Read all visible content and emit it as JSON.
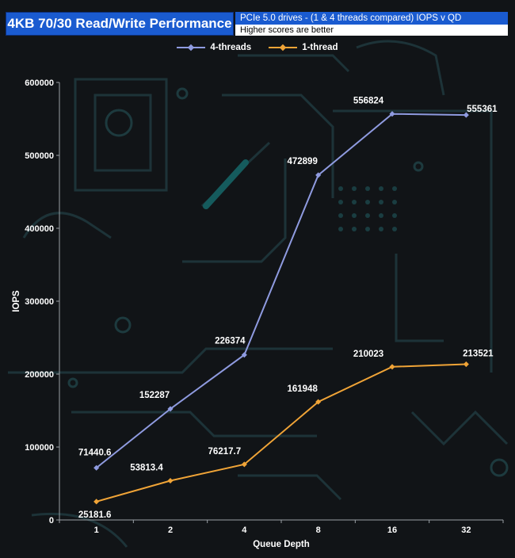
{
  "header": {
    "title": "4KB 70/30 Read/Write Performance",
    "subtitle": "PCIe 5.0 drives - (1 & 4 threads compared) IOPS v QD",
    "note": "Higher scores are better"
  },
  "colors": {
    "title_bg": "#1a5bd0",
    "series_4": "#8f9be0",
    "series_1": "#f0a437",
    "text": "#ffffff"
  },
  "chart_data": {
    "type": "line",
    "title": "4KB 70/30 Read/Write Performance",
    "subtitle": "PCIe 5.0 drives - (1 & 4 threads compared) IOPS v QD",
    "xlabel": "Queue Depth",
    "ylabel": "IOPS",
    "categories": [
      "1",
      "2",
      "4",
      "8",
      "16",
      "32"
    ],
    "ylim": [
      0,
      600000
    ],
    "yticks": [
      0,
      100000,
      200000,
      300000,
      400000,
      500000,
      600000
    ],
    "grid": false,
    "legend_position": "top",
    "series": [
      {
        "name": "4-threads",
        "color": "#8f9be0",
        "values": [
          71440.6,
          152287,
          226374,
          472899,
          556824,
          555361
        ],
        "labels": [
          "71440.6",
          "152287",
          "226374",
          "472899",
          "556824",
          "555361"
        ]
      },
      {
        "name": "1-thread",
        "color": "#f0a437",
        "values": [
          25181.6,
          53813.4,
          76217.7,
          161948,
          210023,
          213521
        ],
        "labels": [
          "25181.6",
          "53813.4",
          "76217.7",
          "161948",
          "210023",
          "213521"
        ]
      }
    ]
  }
}
